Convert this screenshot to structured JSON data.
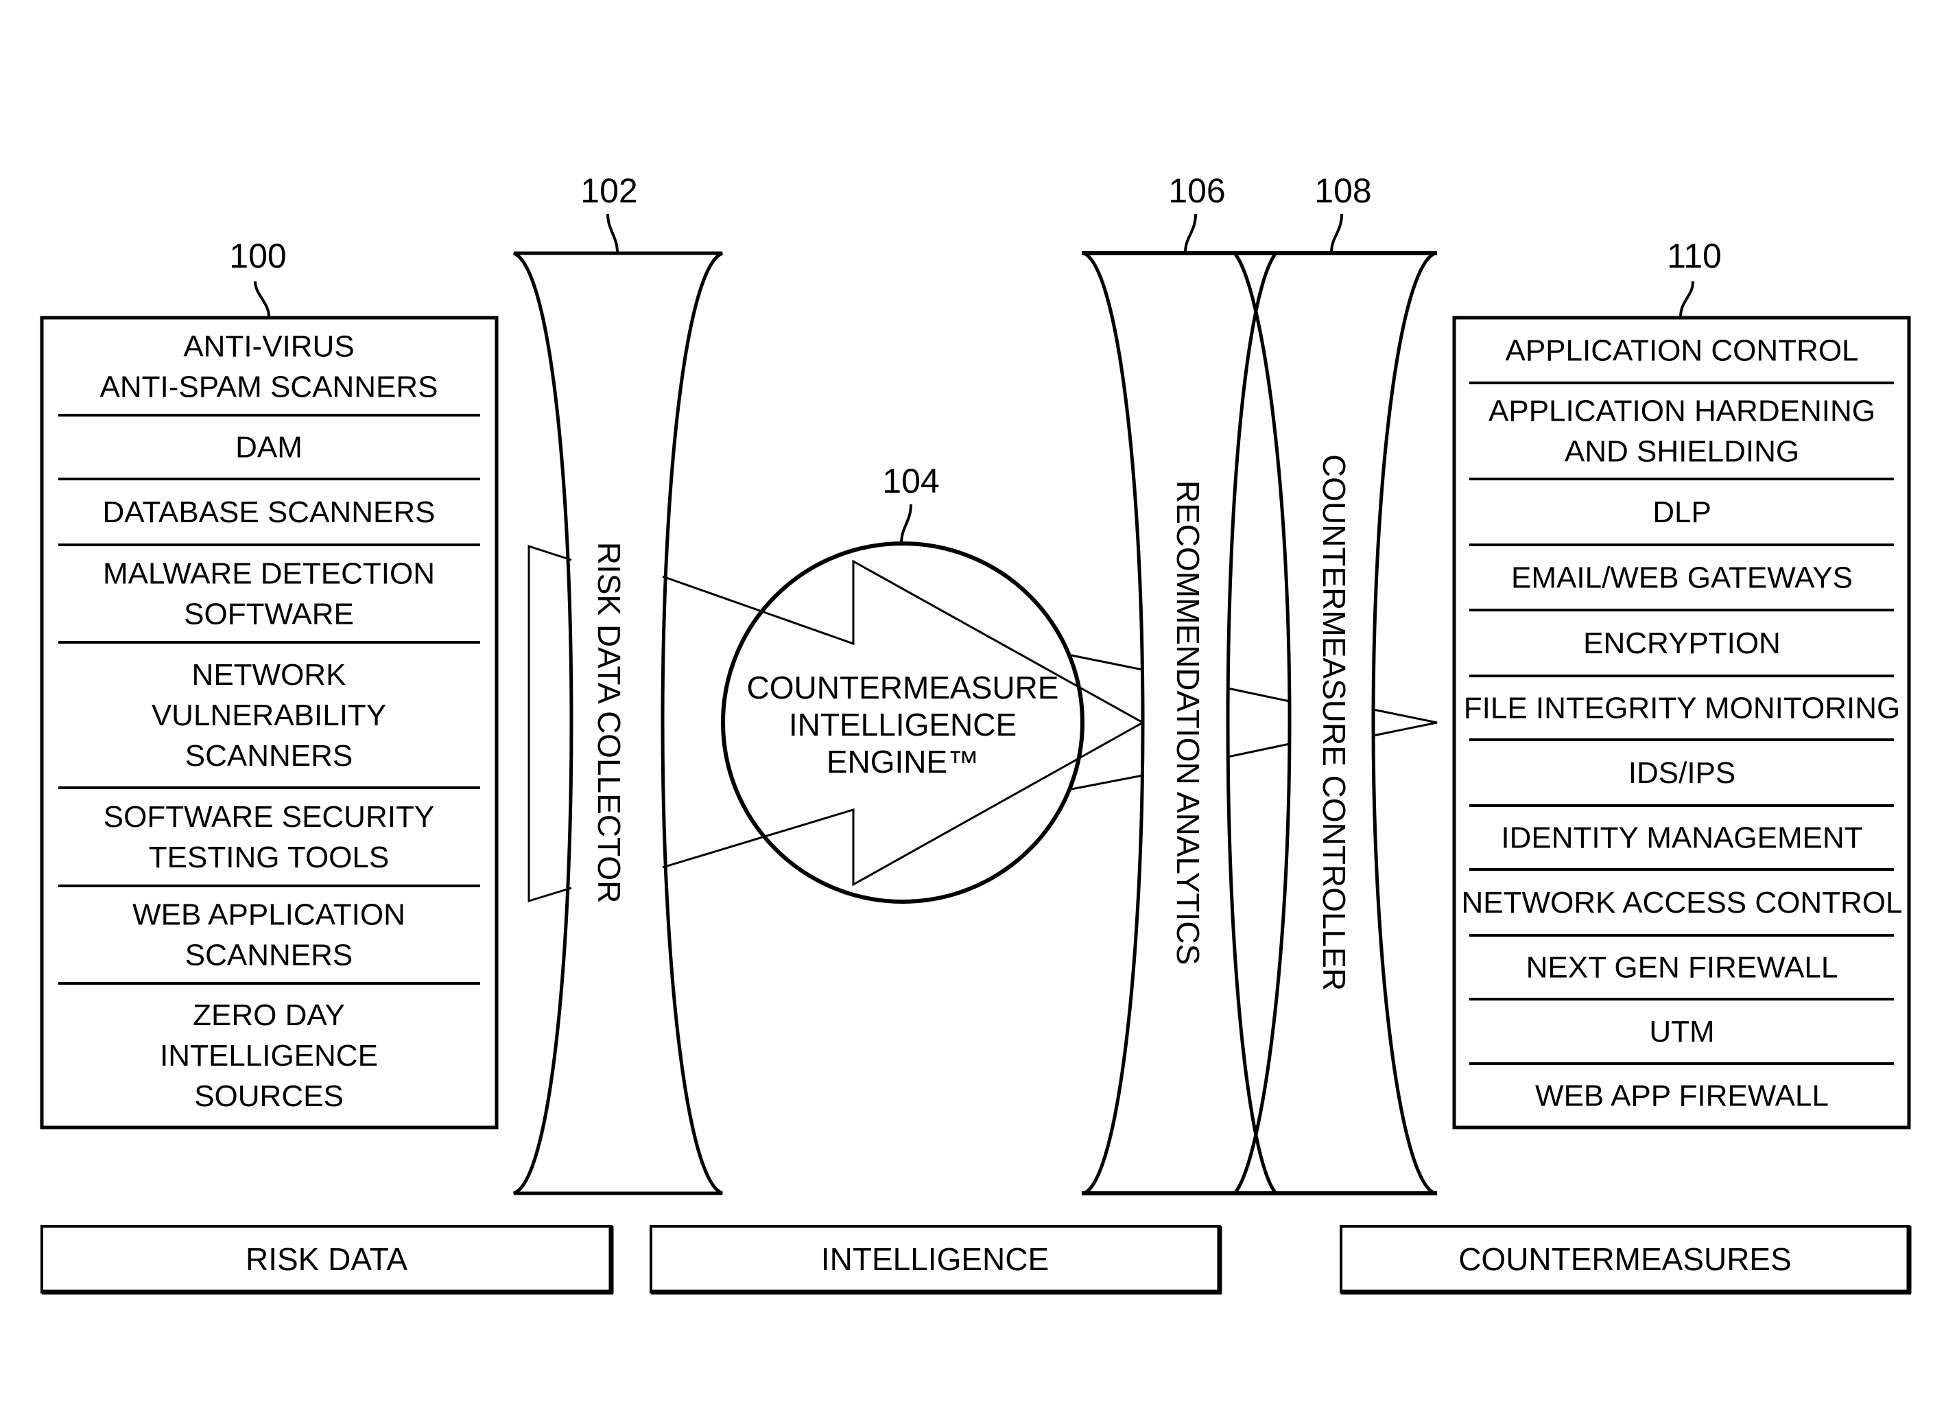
{
  "figure": {
    "reference_numerals": {
      "risk_sources": "100",
      "risk_data_collector": "102",
      "engine": "104",
      "recommendation_analytics": "106",
      "countermeasure_controller": "108",
      "countermeasures": "110"
    },
    "risk_sources": {
      "items": [
        [
          "ANTI-VIRUS",
          "ANTI-SPAM SCANNERS"
        ],
        [
          "DAM"
        ],
        [
          "DATABASE SCANNERS"
        ],
        [
          "MALWARE DETECTION",
          "SOFTWARE"
        ],
        [
          "NETWORK",
          "VULNERABILITY",
          "SCANNERS"
        ],
        [
          "SOFTWARE SECURITY",
          "TESTING TOOLS"
        ],
        [
          "WEB APPLICATION",
          "SCANNERS"
        ],
        [
          "ZERO DAY",
          "INTELLIGENCE",
          "SOURCES"
        ]
      ]
    },
    "risk_data_collector": {
      "label": "RISK DATA COLLECTOR"
    },
    "engine": {
      "lines": [
        "COUNTERMEASURE",
        "INTELLIGENCE",
        "ENGINE™"
      ]
    },
    "recommendation_analytics": {
      "label": "RECOMMENDATION ANALYTICS"
    },
    "countermeasure_controller": {
      "label": "COUNTERMEASURE CONTROLLER"
    },
    "countermeasures": {
      "items": [
        [
          "APPLICATION CONTROL"
        ],
        [
          "APPLICATION HARDENING",
          "AND SHIELDING"
        ],
        [
          "DLP"
        ],
        [
          "EMAIL/WEB GATEWAYS"
        ],
        [
          "ENCRYPTION"
        ],
        [
          "FILE INTEGRITY MONITORING"
        ],
        [
          "IDS/IPS"
        ],
        [
          "IDENTITY MANAGEMENT"
        ],
        [
          "NETWORK ACCESS CONTROL"
        ],
        [
          "NEXT GEN FIREWALL"
        ],
        [
          "UTM"
        ],
        [
          "WEB APP FIREWALL"
        ]
      ]
    },
    "stages": {
      "risk_data": "RISK DATA",
      "intelligence": "INTELLIGENCE",
      "countermeasures": "COUNTERMEASURES"
    }
  }
}
